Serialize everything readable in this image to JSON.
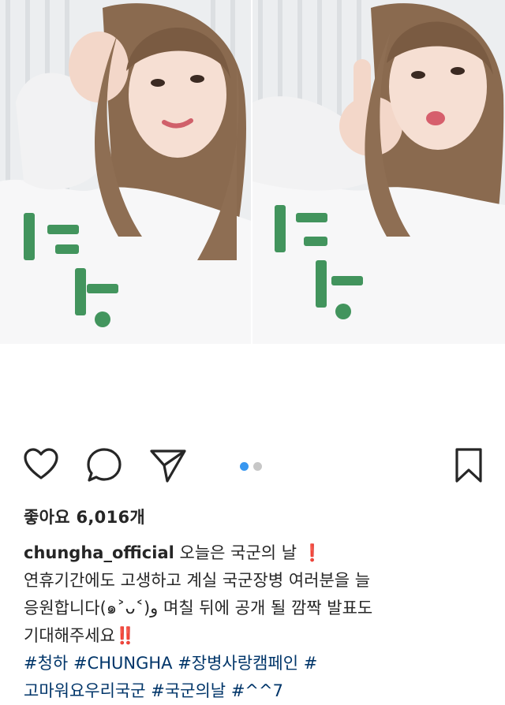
{
  "post": {
    "likes_label": "좋아요 6,016개",
    "username": "chungha_official",
    "caption_line1": "오늘은 국군의 날 ❗",
    "caption_line2": "연휴기간에도 고생하고 계실 국군장병 여러분을 늘",
    "caption_line3": "응원합니다(๑˃ᴗ˂)و 며칠 뒤에 공개 될 깜짝 발표도",
    "caption_line4": "기대해주세요‼️",
    "hashtags": [
      "#청하",
      "#CHUNGHA",
      "#장병사랑캠페인",
      "#",
      "고마워요우리국군",
      "#국군의날",
      "#^^7"
    ]
  },
  "carousel": {
    "current": 1,
    "total": 2
  },
  "icons": {
    "like": "heart-icon",
    "comment": "comment-bubble-icon",
    "share": "send-arrow-icon",
    "save": "bookmark-icon"
  },
  "colors": {
    "text": "#262626",
    "hashtag": "#003569",
    "dot_active": "#3897f0",
    "dot_inactive": "#c7c7c7"
  }
}
